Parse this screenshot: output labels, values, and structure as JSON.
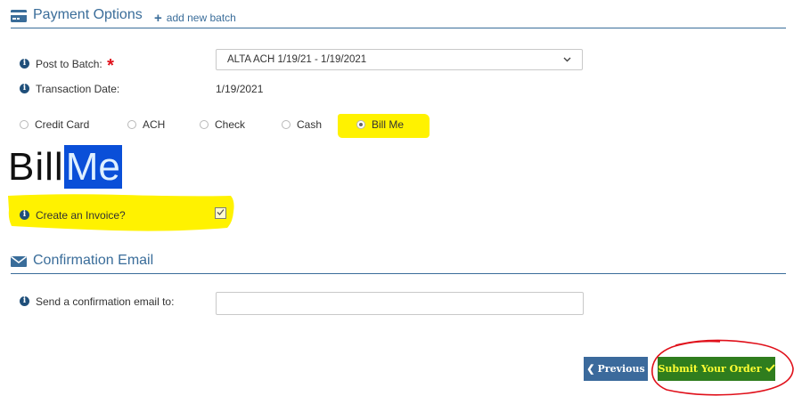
{
  "payment": {
    "title": "Payment Options",
    "add_batch": "add new batch",
    "post_to_batch_label": "Post to Batch:",
    "required_mark": "*",
    "batch_value": "ALTA ACH 1/19/21 - 1/19/2021",
    "transaction_date_label": "Transaction Date:",
    "transaction_date_value": "1/19/2021",
    "methods": [
      "Credit Card",
      "ACH",
      "Check",
      "Cash",
      "Bill Me"
    ],
    "selected_method": "Bill Me",
    "logo_part1": "Bill",
    "logo_part2": "Me",
    "invoice_label": "Create an Invoice?",
    "invoice_checked": true
  },
  "email": {
    "title": "Confirmation Email",
    "send_label": "Send a confirmation email to:",
    "value": ""
  },
  "buttons": {
    "previous": "Previous",
    "submit": "Submit Your Order"
  },
  "colors": {
    "accent": "#3a6d9a",
    "highlight": "#fff200",
    "submit_bg": "#2f7d1e",
    "submit_text": "#ffff33",
    "annotation": "#e0101a"
  }
}
